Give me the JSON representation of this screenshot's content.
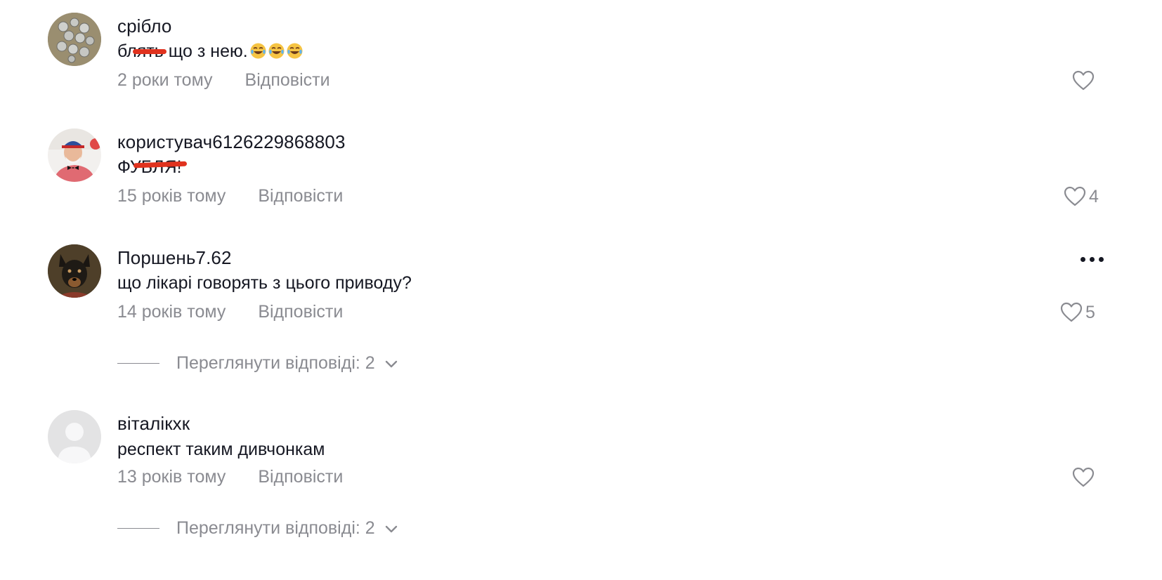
{
  "comments": [
    {
      "username": "срібло",
      "text": "блять що з нею.",
      "emojis": [
        "face-with-tears-of-joy",
        "face-with-tears-of-joy",
        "face-with-tears-of-joy"
      ],
      "time": "2 роки тому",
      "reply_label": "Відповісти",
      "likes": "",
      "avatar": "coins-photo"
    },
    {
      "username": "користувач6126229868803",
      "text": "ФУБЛЯ!",
      "time": "15 років тому",
      "reply_label": "Відповісти",
      "likes": "4",
      "avatar": "man-with-cap-photo"
    },
    {
      "username": "Поршень7.62",
      "text": "що лікарі говорять з цього приводу?",
      "time": "14 років тому",
      "reply_label": "Відповісти",
      "likes": "5",
      "avatar": "dog-photo",
      "view_replies": "Переглянути відповіді: 2"
    },
    {
      "username": "віталікхк",
      "text": "респект таким дивчонкам",
      "time": "13 років тому",
      "reply_label": "Відповісти",
      "likes": "",
      "avatar": "default-avatar",
      "view_replies": "Переглянути відповіді: 2"
    }
  ],
  "colors": {
    "text_primary": "#161823",
    "text_secondary": "#8a8b91",
    "censor_mark": "#e0321e"
  }
}
